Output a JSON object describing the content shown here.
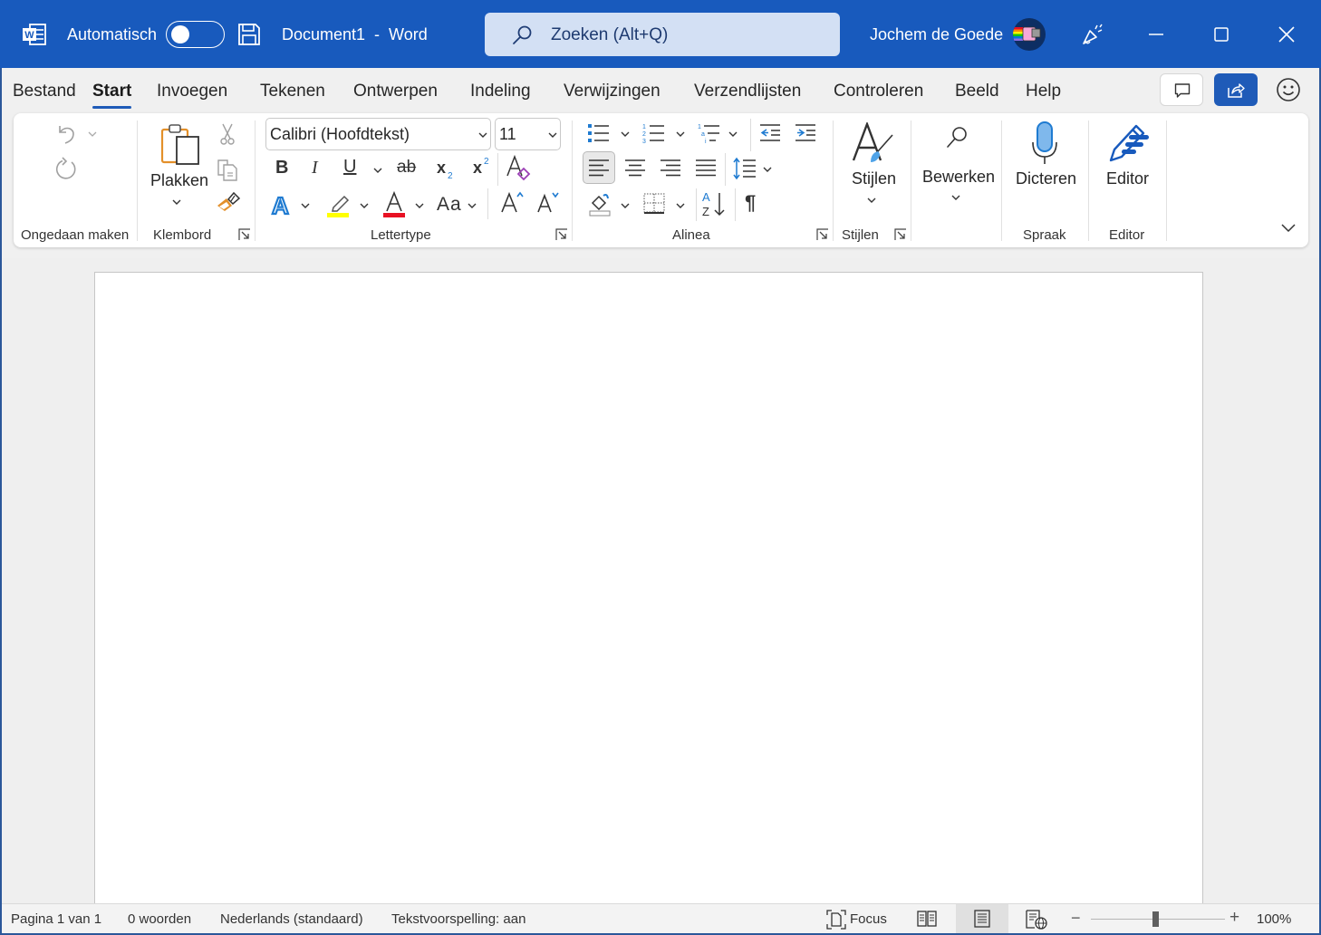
{
  "titlebar": {
    "app_icon": "word-logo-icon",
    "autosave_label": "Automatisch",
    "autosave_on": false,
    "doc_title": "Document1  -  Word",
    "search_placeholder": "Zoeken (Alt+Q)",
    "user_name": "Jochem de Goede",
    "window_controls": [
      "minimize",
      "maximize",
      "close"
    ]
  },
  "tabs": [
    {
      "label": "Bestand",
      "active": false
    },
    {
      "label": "Start",
      "active": true
    },
    {
      "label": "Invoegen",
      "active": false
    },
    {
      "label": "Tekenen",
      "active": false
    },
    {
      "label": "Ontwerpen",
      "active": false
    },
    {
      "label": "Indeling",
      "active": false
    },
    {
      "label": "Verwijzingen",
      "active": false
    },
    {
      "label": "Verzendlijsten",
      "active": false
    },
    {
      "label": "Controleren",
      "active": false
    },
    {
      "label": "Beeld",
      "active": false
    },
    {
      "label": "Help",
      "active": false
    }
  ],
  "ribbon": {
    "groups": {
      "undo": {
        "label": "Ongedaan maken"
      },
      "clipboard": {
        "label": "Klembord",
        "paste_label": "Plakken"
      },
      "font": {
        "label": "Lettertype",
        "font_name": "Calibri (Hoofdtekst)",
        "font_size": "11"
      },
      "paragraph": {
        "label": "Alinea"
      },
      "styles": {
        "label": "Stijlen",
        "button_label": "Stijlen"
      },
      "editing": {
        "button_label": "Bewerken"
      },
      "voice": {
        "label": "Spraak",
        "button_label": "Dicteren"
      },
      "editor": {
        "label": "Editor",
        "button_label": "Editor"
      }
    },
    "colors": {
      "highlight": "#ffff00",
      "font_color": "#e81123",
      "accent": "#185abd"
    }
  },
  "statusbar": {
    "page": "Pagina 1 van 1",
    "words": "0 woorden",
    "language": "Nederlands (standaard)",
    "text_prediction": "Tekstvoorspelling: aan",
    "focus": "Focus",
    "zoom_minus": "−",
    "zoom_plus": "+",
    "zoom_level": "100%",
    "zoom_percent": 100
  }
}
